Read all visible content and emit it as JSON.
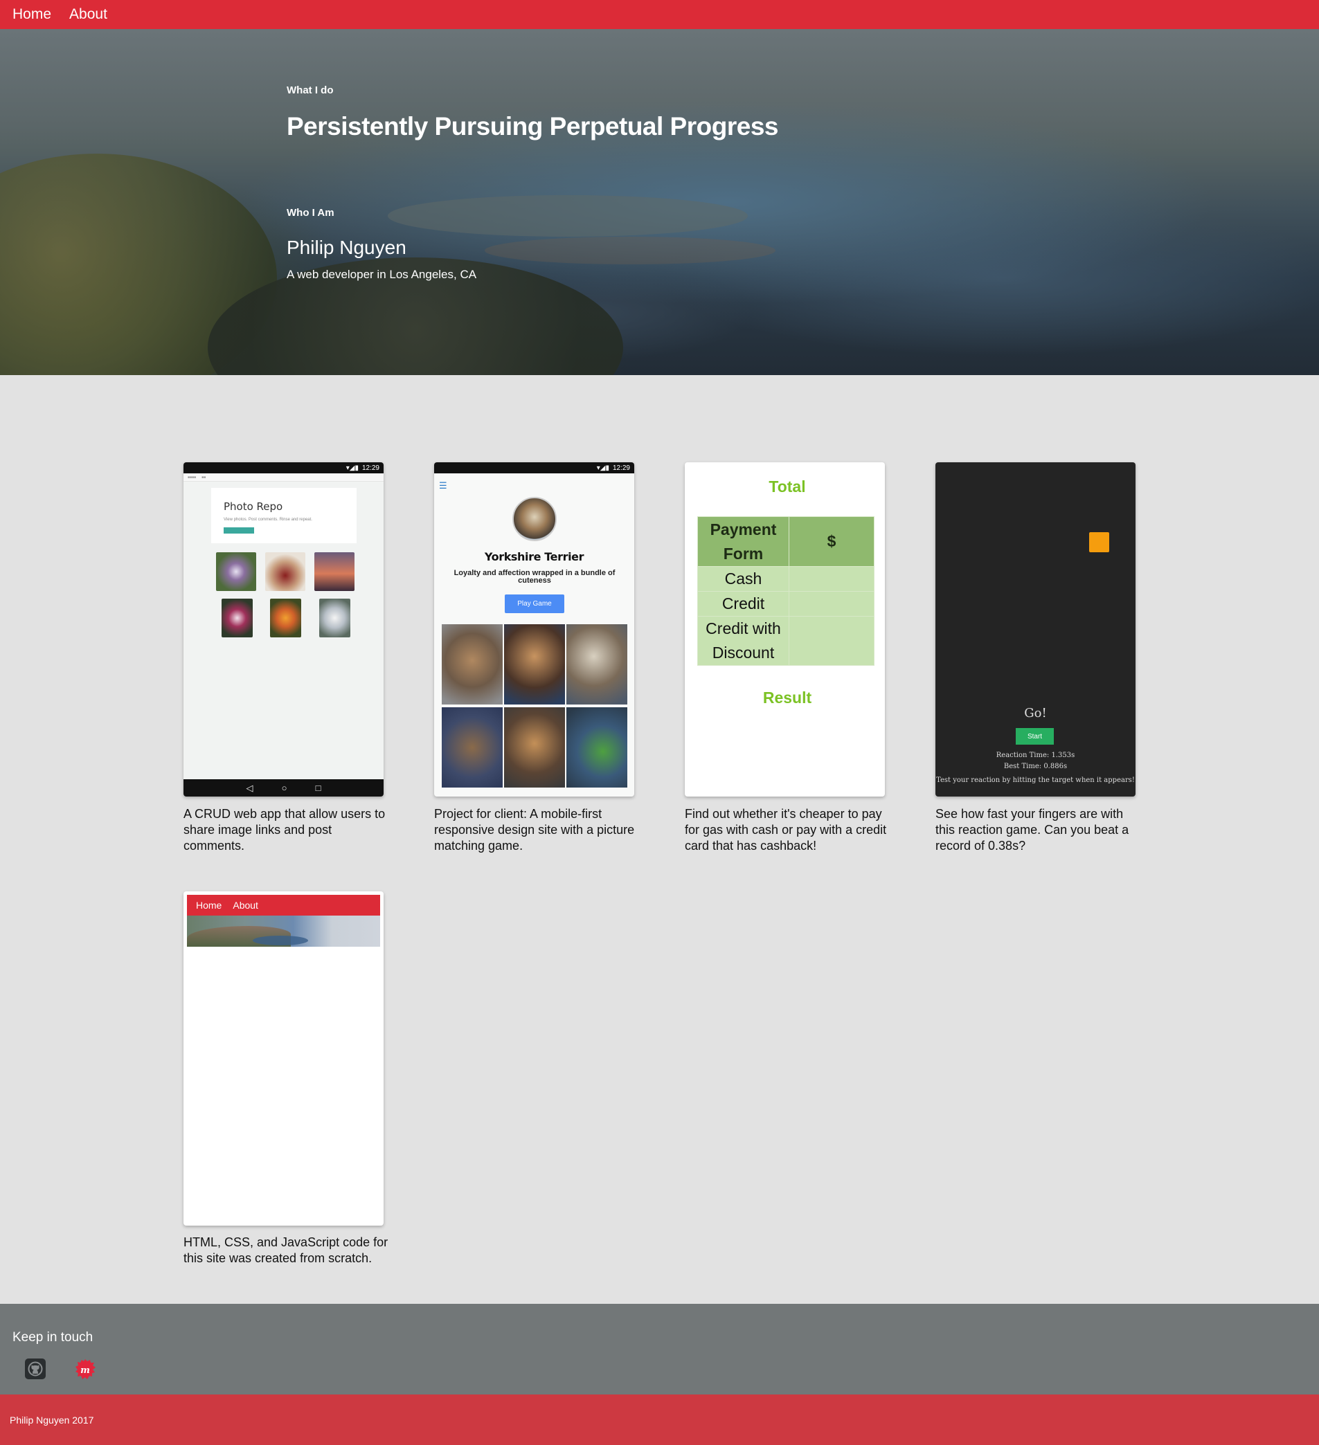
{
  "nav": {
    "home": "Home",
    "about": "About"
  },
  "hero": {
    "eyebrow": "What I do",
    "headline": "Persistently Pursuing Perpetual Progress",
    "eyebrow2": "Who I Am",
    "name": "Philip Nguyen",
    "tagline": "A web developer in Los Angeles, CA"
  },
  "projects": [
    {
      "status_time": "12:29",
      "app_title": "Photo Repo",
      "app_subtitle": "View photos. Post comments. Rinse and repeat.",
      "caption": "A CRUD web app that allow users to share image links and post comments."
    },
    {
      "status_time": "12:29",
      "app_title": "Yorkshire Terrier",
      "app_subtitle": "Loyalty and affection wrapped in a bundle of cuteness",
      "button": "Play Game",
      "caption": "Project for client: A mobile-first responsive design site with a picture matching game."
    },
    {
      "total_label": "Total",
      "table": {
        "headers": [
          "Payment Form",
          "$"
        ],
        "rows": [
          "Cash",
          "Credit",
          "Credit with Discount"
        ]
      },
      "result_label": "Result",
      "caption": "Find out whether it's cheaper to pay for gas with cash or pay with a credit card that has cashback!"
    },
    {
      "go": "Go!",
      "start": "Start",
      "reaction_time": "Reaction Time: 1.353s",
      "best_time": "Best Time: 0.886s",
      "tip": "Test your reaction by hitting the target when it appears!",
      "caption": "See how fast your fingers are with this reaction game. Can you beat a record of 0.38s?"
    },
    {
      "mini_nav_home": "Home",
      "mini_nav_about": "About",
      "caption": "HTML, CSS, and JavaScript code for this site was created from scratch."
    }
  ],
  "footer": {
    "keep_in_touch": "Keep in touch",
    "icons": [
      "github-icon",
      "meetup-icon"
    ],
    "copyright": "Philip Nguyen 2017"
  },
  "colors": {
    "brand_red": "#dc2b37",
    "footer_gray": "#727778",
    "bottom_red": "#cd3941",
    "accent_green": "#7cc225"
  }
}
